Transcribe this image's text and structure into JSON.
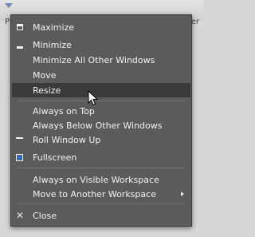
{
  "background": {
    "left_text": "P",
    "right_text": "er"
  },
  "menu": {
    "items": [
      {
        "label": "Maximize",
        "icon": "maximize-icon"
      },
      {
        "label": "Minimize",
        "icon": "minimize-icon"
      },
      {
        "label": "Minimize All Other Windows"
      },
      {
        "label": "Move"
      },
      {
        "label": "Resize",
        "highlighted": true
      },
      {
        "label": "Always on Top"
      },
      {
        "label": "Always Below Other Windows"
      },
      {
        "label": "Roll Window Up",
        "icon": "roll-up-icon"
      },
      {
        "label": "Fullscreen",
        "icon": "fullscreen-icon"
      },
      {
        "label": "Always on Visible Workspace"
      },
      {
        "label": "Move to Another Workspace",
        "has_submenu": true
      },
      {
        "label": "Close",
        "icon": "close-icon"
      }
    ]
  },
  "colors": {
    "menu_bg": "#5b5b5b",
    "highlight_bg": "#3b3b3b",
    "text": "#f2f2f2"
  }
}
